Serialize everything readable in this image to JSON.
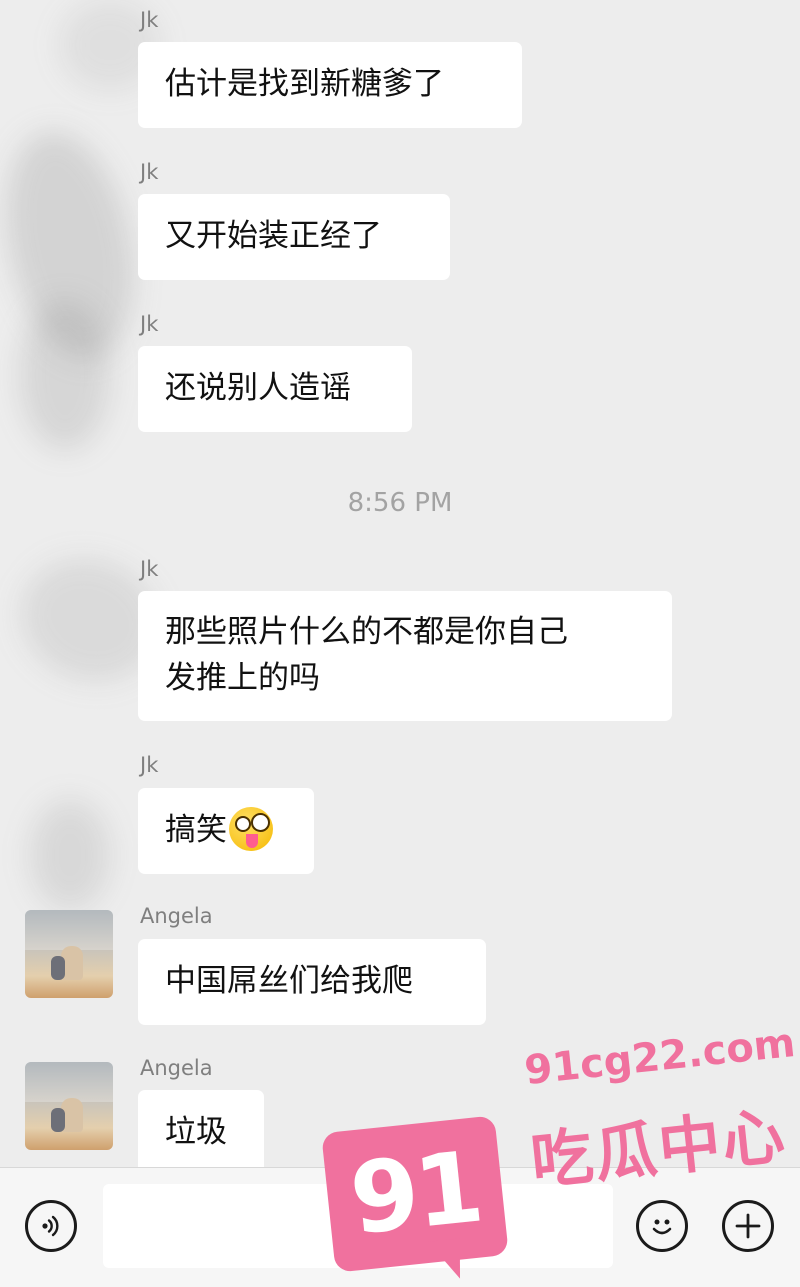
{
  "messages": [
    {
      "sender": "Jk",
      "text": "估计是找到新糖爹了"
    },
    {
      "sender": "Jk",
      "text": "又开始装正经了"
    },
    {
      "sender": "Jk",
      "text": "还说别人造谣"
    },
    {
      "sender": "Jk",
      "text_line1": "那些照片什么的不都是你自己",
      "text_line2": "发推上的吗"
    },
    {
      "sender": "Jk",
      "text": "搞笑",
      "emoji": "zany-face-emoji"
    },
    {
      "sender": "Angela",
      "text": "中国屌丝们给我爬"
    },
    {
      "sender": "Angela",
      "text": "垃圾"
    }
  ],
  "timestamp": "8:56 PM",
  "input_bar": {
    "voice_icon": "voice-icon",
    "emoji_icon": "smiley-icon",
    "plus_icon": "plus-icon",
    "input_value": ""
  },
  "watermark": {
    "badge": "91",
    "domain": "91cg22.com",
    "title": "吃瓜中心",
    "color": "#f0719e"
  }
}
